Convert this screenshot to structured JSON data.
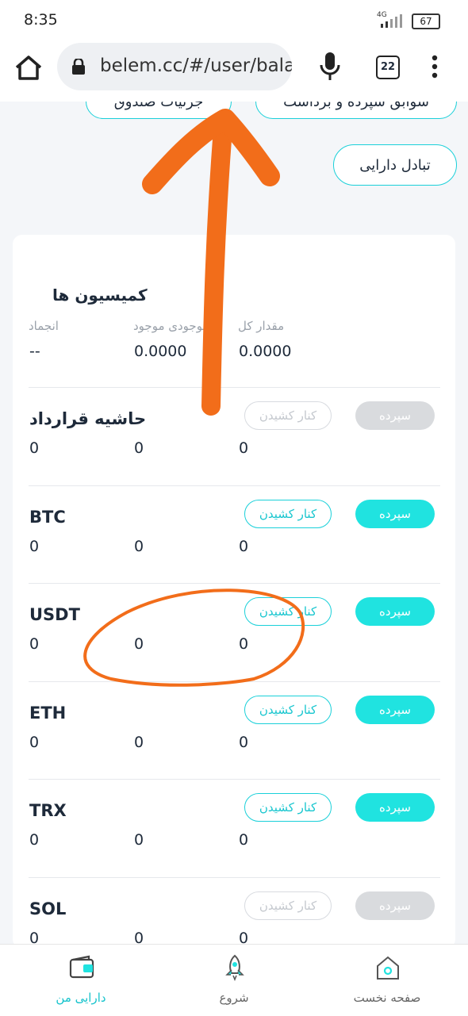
{
  "status_bar": {
    "time": "8:35",
    "network": "4G",
    "battery": "67"
  },
  "browser": {
    "url": "belem.cc/#/user/bala",
    "tab_count": "22"
  },
  "top_buttons": {
    "fund_details": "جزئیات صندوق",
    "deposit_withdraw_history": "سوابق سپرده و برداشت",
    "asset_exchange": "تبادل دارایی"
  },
  "commissions": {
    "title": "کمیسیون ها",
    "col_total": "مقدار کل",
    "col_available": "موجودی موجود",
    "col_frozen": "انجماد",
    "val_total": "0.0000",
    "val_available": "0.0000",
    "val_frozen": "--"
  },
  "action_labels": {
    "withdraw": "کنار کشیدن",
    "deposit": "سپرده"
  },
  "assets": [
    {
      "name": "حاشیه قرارداد",
      "total": "0",
      "available": "0",
      "frozen": "0",
      "enabled": false
    },
    {
      "name": "BTC",
      "total": "0",
      "available": "0",
      "frozen": "0",
      "enabled": true
    },
    {
      "name": "USDT",
      "total": "0",
      "available": "0",
      "frozen": "0",
      "enabled": true
    },
    {
      "name": "ETH",
      "total": "0",
      "available": "0",
      "frozen": "0",
      "enabled": true
    },
    {
      "name": "TRX",
      "total": "0",
      "available": "0",
      "frozen": "0",
      "enabled": true
    },
    {
      "name": "SOL",
      "total": "0",
      "available": "0",
      "frozen": "0",
      "enabled": false
    }
  ],
  "bottom_nav": {
    "my_assets": "دارایی من",
    "start": "شروع",
    "home": "صفحه نخست"
  },
  "colors": {
    "accent": "#20e3e0",
    "annotation": "#f26d1a"
  }
}
